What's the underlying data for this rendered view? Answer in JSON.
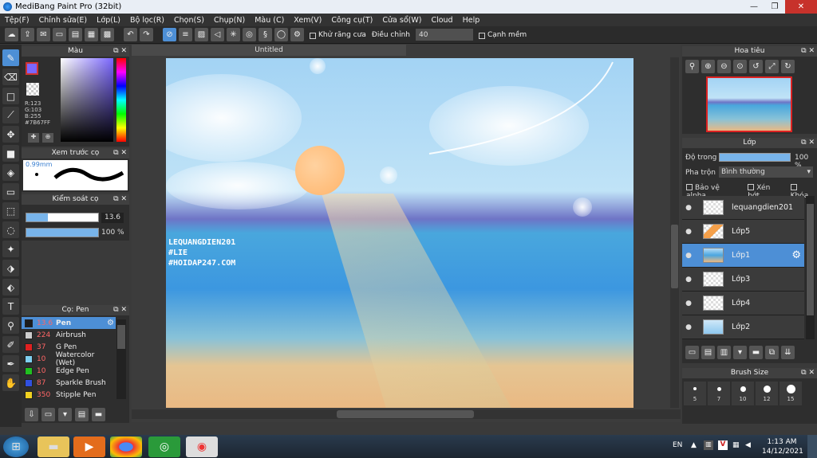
{
  "window": {
    "title": "MediBang Paint Pro (32bit)"
  },
  "menu": [
    "Tệp(F)",
    "Chỉnh sửa(E)",
    "Lớp(L)",
    "Bộ lọc(R)",
    "Chọn(S)",
    "Chụp(N)",
    "Màu (C)",
    "Xem(V)",
    "Công cụ(T)",
    "Cửa sổ(W)",
    "Cloud",
    "Help"
  ],
  "toolbar": {
    "antialias_label": "Khử răng cưa",
    "correction_label": "Điều chỉnh",
    "correction_value": "40",
    "edge_label": "Cạnh mềm"
  },
  "color_panel": {
    "title": "Màu",
    "r": "R:123",
    "g": "G:103",
    "b": "B:255",
    "hex": "#7B67FF",
    "primary": "#7b67ff"
  },
  "preview_panel": {
    "title": "Xem trước cọ",
    "size": "0.99mm"
  },
  "brush_control": {
    "title": "Kiểm soát cọ",
    "size_value": "13.6",
    "opacity_value": "100 %",
    "size_level": 0.3,
    "opacity_level": 1.0
  },
  "brush_panel": {
    "title": "Cọ: Pen",
    "brushes": [
      {
        "size": "13.6",
        "name": "Pen",
        "color": "#1c1c1c"
      },
      {
        "size": "224",
        "name": "Airbrush",
        "color": "#cccccc"
      },
      {
        "size": "37",
        "name": "G Pen",
        "color": "#e02020"
      },
      {
        "size": "10",
        "name": "Watercolor (Wet)",
        "color": "#7fd0f0"
      },
      {
        "size": "10",
        "name": "Edge Pen",
        "color": "#20c020"
      },
      {
        "size": "87",
        "name": "Sparkle Brush",
        "color": "#3050e0"
      },
      {
        "size": "350",
        "name": "Stipple Pen",
        "color": "#f0d020"
      }
    ]
  },
  "document": {
    "tab": "Untitled",
    "watermark": [
      "LEQUANGDIEN201",
      "#LIE",
      "#HOIDAP247.COM"
    ]
  },
  "navigator": {
    "title": "Hoa tiêu"
  },
  "layer_panel": {
    "title": "Lớp",
    "opacity_label": "Độ trong",
    "opacity_value": "100 %",
    "blend_label": "Pha trộn",
    "blend_value": "Bình thường",
    "alpha_label": "Bảo vệ alpha",
    "clip_label": "Xén bớt",
    "lock_label": "Khóa",
    "layers": [
      "lequangdien201",
      "Lớp5",
      "Lớp1",
      "Lớp3",
      "Lớp4",
      "Lớp2"
    ]
  },
  "brush_size": {
    "title": "Brush Size",
    "sizes": [
      "5",
      "7",
      "10",
      "12",
      "15"
    ]
  },
  "taskbar": {
    "lang": "EN",
    "time": "1:13 AM",
    "date": "14/12/2021"
  }
}
